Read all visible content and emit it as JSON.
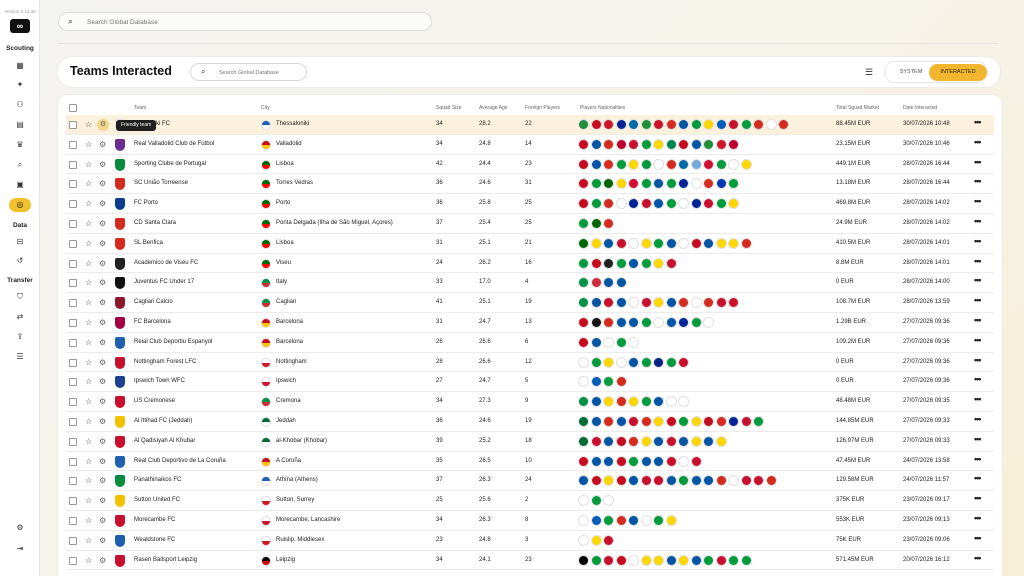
{
  "app": {
    "version": "Version 0.12.30",
    "logo_text": "∞",
    "sections": {
      "scouting": "Scouting",
      "data": "Data",
      "transfer": "Transfer"
    }
  },
  "top_search": {
    "placeholder": "Search Global Database"
  },
  "header": {
    "title": "Teams Interacted",
    "search_placeholder": "Search Global Database",
    "toggle": {
      "system": "SYSTEM",
      "interacted": "INTERACTED",
      "active": "interacted"
    }
  },
  "table": {
    "columns": {
      "team": "Team",
      "city": "City",
      "squad_size": "Squad Size",
      "average_age": "Average Age",
      "foreign_players": "Foreign Players",
      "players_nationalities": "Players Nationalities",
      "total_squad_market": "Total Squad Market",
      "date_interacted": "Date Interacted"
    },
    "tooltip": "Friendly team",
    "rows": [
      {
        "team": "Thessaloniki FC",
        "team_visible": "essaloniki FC",
        "city": "Thessaloniki",
        "squad": "34",
        "age": "28.2",
        "foreign": "22",
        "market": "88.45M EUR",
        "date": "30/07/2026 10:48",
        "cflag": [
          "#1f5fb0",
          "#ffffff"
        ],
        "crest": "#e6e6e6",
        "flags": [
          "#1f8f3a",
          "#c60b1e",
          "#cf142b",
          "#002395",
          "#006aa7",
          "#1f8f3a",
          "#ce1126",
          "#d52b1e",
          "#0055a4",
          "#009b3a",
          "#ffd700",
          "#005eb8",
          "#c8102e",
          "#009b3a",
          "#d52b1e",
          "#ffffff",
          "#d52b1e"
        ]
      },
      {
        "team": "Real Valladolid Club de Fútbol",
        "city": "Valladolid",
        "squad": "34",
        "age": "24.8",
        "foreign": "14",
        "market": "23.15M EUR",
        "date": "30/07/2026 10:46",
        "cflag": [
          "#c60b1e",
          "#ffc400"
        ],
        "crest": "#6a2c91",
        "flags": [
          "#c60b1e",
          "#0055a4",
          "#d52b1e",
          "#bc002d",
          "#c8102e",
          "#009b3a",
          "#ffd700",
          "#008751",
          "#c60b1e",
          "#0055a4",
          "#1f8f3a",
          "#cf142b",
          "#bc002d"
        ]
      },
      {
        "team": "Sporting Clube de Portugal",
        "city": "Lisboa",
        "squad": "42",
        "age": "24.4",
        "foreign": "23",
        "market": "449.1M EUR",
        "date": "28/07/2026 16:44",
        "cflag": [
          "#006600",
          "#ff0000"
        ],
        "crest": "#0a8a3c",
        "flags": [
          "#c60b1e",
          "#0055a4",
          "#d52b1e",
          "#009b3a",
          "#ffd700",
          "#009b3a",
          "#ffffff",
          "#d52b1e",
          "#006aa7",
          "#75aadb",
          "#d21034",
          "#009b3a",
          "#ffffff",
          "#ffd700"
        ]
      },
      {
        "team": "SC União Torreense",
        "city": "Torres Vedras",
        "squad": "36",
        "age": "24.6",
        "foreign": "31",
        "market": "13.18M EUR",
        "date": "28/07/2026 16:44",
        "cflag": [
          "#006600",
          "#ff0000"
        ],
        "crest": "#d52b1e",
        "flags": [
          "#c60b1e",
          "#009b3a",
          "#006600",
          "#ffd700",
          "#d21034",
          "#009b3a",
          "#0055a4",
          "#009b3a",
          "#002395",
          "#ffffff",
          "#d52b1e",
          "#0038b8",
          "#009b3a"
        ]
      },
      {
        "team": "FC Porto",
        "city": "Porto",
        "squad": "36",
        "age": "25.8",
        "foreign": "25",
        "market": "469.8M EUR",
        "date": "28/07/2026 14:02",
        "cflag": [
          "#006600",
          "#ff0000"
        ],
        "crest": "#0b3c8c",
        "flags": [
          "#c60b1e",
          "#009b3a",
          "#d52b1e",
          "#ffffff",
          "#002395",
          "#c8102e",
          "#0055a4",
          "#009b3a",
          "#ffffff",
          "#002395",
          "#c8102e",
          "#009b3a",
          "#ffd700"
        ]
      },
      {
        "team": "CD Santa Clara",
        "city": "Ponta Delgada (Ilha de São Miguel, Açores)",
        "squad": "37",
        "age": "25.4",
        "foreign": "25",
        "market": "24.9M EUR",
        "date": "28/07/2026 14:02",
        "cflag": [
          "#006600",
          "#ff0000"
        ],
        "crest": "#d52b1e",
        "flags": [
          "#009b3a",
          "#006600",
          "#d52b1e"
        ]
      },
      {
        "team": "SL Benfica",
        "city": "Lisboa",
        "squad": "31",
        "age": "25.1",
        "foreign": "21",
        "market": "410.5M EUR",
        "date": "28/07/2026 14:01",
        "cflag": [
          "#006600",
          "#ff0000"
        ],
        "crest": "#d52b1e",
        "flags": [
          "#006600",
          "#ffd700",
          "#0055a4",
          "#c8102e",
          "#ffffff",
          "#ffd700",
          "#009b3a",
          "#0055a4",
          "#ffffff",
          "#c60b1e",
          "#0055a4",
          "#ffd700",
          "#ffd700",
          "#d52b1e"
        ]
      },
      {
        "team": "Academico de Viseu FC",
        "city": "Viseu",
        "squad": "24",
        "age": "26.2",
        "foreign": "16",
        "market": "8.8M EUR",
        "date": "28/07/2026 14:01",
        "cflag": [
          "#006600",
          "#ff0000"
        ],
        "crest": "#222222",
        "flags": [
          "#009b3a",
          "#c60b1e",
          "#222222",
          "#009b3a",
          "#0055a4",
          "#009b3a",
          "#ffd700",
          "#c8102e"
        ]
      },
      {
        "team": "Juventus FC Under 17",
        "city": "Italy",
        "squad": "33",
        "age": "17.0",
        "foreign": "4",
        "market": "0 EUR",
        "date": "28/07/2026 14:00",
        "cflag": [
          "#009246",
          "#ce2b37"
        ],
        "crest": "#111111",
        "flags": [
          "#009246",
          "#cd2a3e",
          "#0055a4",
          "#0055a4"
        ]
      },
      {
        "team": "Cagliari Calcio",
        "city": "Cagliari",
        "squad": "41",
        "age": "25.1",
        "foreign": "19",
        "market": "108.7M EUR",
        "date": "28/07/2026 13:59",
        "cflag": [
          "#009246",
          "#ce2b37"
        ],
        "crest": "#8b1a2b",
        "flags": [
          "#009246",
          "#0055a4",
          "#c8102e",
          "#0055a4",
          "#ffffff",
          "#c8102e",
          "#ffd700",
          "#0055a4",
          "#d52b1e",
          "#ffffff",
          "#d52b1e",
          "#c8102e",
          "#ce1126"
        ]
      },
      {
        "team": "FC Barcelona",
        "city": "Barcelona",
        "squad": "31",
        "age": "24.7",
        "foreign": "13",
        "market": "1.29B EUR",
        "date": "27/07/2026 09:36",
        "cflag": [
          "#c60b1e",
          "#ffc400"
        ],
        "crest": "#a50044",
        "flags": [
          "#c60b1e",
          "#111111",
          "#d52b1e",
          "#0055a4",
          "#0055a4",
          "#009b3a",
          "#ffffff",
          "#0055a4",
          "#002395",
          "#009b3a",
          "#ffffff"
        ]
      },
      {
        "team": "Reial Club Deportiu Espanyol",
        "city": "Barcelona",
        "squad": "26",
        "age": "26.6",
        "foreign": "6",
        "market": "109.2M EUR",
        "date": "27/07/2026 09:36",
        "cflag": [
          "#c60b1e",
          "#ffc400"
        ],
        "crest": "#1f5fb0",
        "flags": [
          "#c60b1e",
          "#0055a4",
          "#ffffff",
          "#009b3a",
          "#ffffff"
        ]
      },
      {
        "team": "Nottingham Forest LFC",
        "city": "Nottingham",
        "squad": "28",
        "age": "26.6",
        "foreign": "12",
        "market": "0 EUR",
        "date": "27/07/2026 09:36",
        "cflag": [
          "#ffffff",
          "#cf142b"
        ],
        "crest": "#c8102e",
        "flags": [
          "#ffffff",
          "#009b3a",
          "#ffd700",
          "#ffffff",
          "#0055a4",
          "#009b3a",
          "#00247d",
          "#009b3a",
          "#c8102e"
        ]
      },
      {
        "team": "Ipswich Town WFC",
        "city": "Ipswich",
        "squad": "27",
        "age": "24.7",
        "foreign": "5",
        "market": "0 EUR",
        "date": "27/07/2026 09:36",
        "cflag": [
          "#ffffff",
          "#cf142b"
        ],
        "crest": "#1d3f8f",
        "flags": [
          "#ffffff",
          "#005eb8",
          "#009b3a",
          "#d52b1e"
        ]
      },
      {
        "team": "US Cremonese",
        "city": "Cremona",
        "squad": "34",
        "age": "27.3",
        "foreign": "9",
        "market": "48.48M EUR",
        "date": "27/07/2026 09:35",
        "cflag": [
          "#009246",
          "#ce2b37"
        ],
        "crest": "#c8102e",
        "flags": [
          "#009246",
          "#0055a4",
          "#ffd700",
          "#d52b1e",
          "#ffd700",
          "#009b3a",
          "#0055a4",
          "#ffffff",
          "#ffffff"
        ]
      },
      {
        "team": "Al Ittihad FC (Jeddah)",
        "city": "Jeddah",
        "squad": "36",
        "age": "24.6",
        "foreign": "19",
        "market": "144.85M EUR",
        "date": "27/07/2026 09:33",
        "cflag": [
          "#006c35",
          "#ffffff"
        ],
        "crest": "#f2c200",
        "flags": [
          "#006c35",
          "#0055a4",
          "#d52b1e",
          "#0055a4",
          "#c8102e",
          "#d52b1e",
          "#ffd700",
          "#c60b1e",
          "#009b3a",
          "#ffd700",
          "#c60b1e",
          "#d52b1e",
          "#002395",
          "#c8102e",
          "#009b3a"
        ]
      },
      {
        "team": "Al Qadisiyah Al Khubar",
        "city": "al-Khobar (Khobar)",
        "squad": "39",
        "age": "25.2",
        "foreign": "18",
        "market": "126.97M EUR",
        "date": "27/07/2026 09:33",
        "cflag": [
          "#006c35",
          "#ffffff"
        ],
        "crest": "#c8102e",
        "flags": [
          "#006c35",
          "#c8102e",
          "#0055a4",
          "#c60b1e",
          "#d52b1e",
          "#ffd700",
          "#0055a4",
          "#c8102e",
          "#0055a4",
          "#ffd700",
          "#0055a4",
          "#ffd700"
        ]
      },
      {
        "team": "Real Club Deportivo de La Coruña",
        "city": "A Coruña",
        "squad": "35",
        "age": "26.5",
        "foreign": "10",
        "market": "47.45M EUR",
        "date": "24/07/2026 13:58",
        "cflag": [
          "#c60b1e",
          "#ffc400"
        ],
        "crest": "#1f5fb0",
        "flags": [
          "#c60b1e",
          "#0055a4",
          "#0055a4",
          "#c60b1e",
          "#009b3a",
          "#0055a4",
          "#0055a4",
          "#c8102e",
          "#ffffff",
          "#c8102e"
        ]
      },
      {
        "team": "Panathinaikos FC",
        "city": "Athína (Athens)",
        "squad": "37",
        "age": "26.3",
        "foreign": "24",
        "market": "129.58M EUR",
        "date": "24/07/2026 11:57",
        "cflag": [
          "#1f5fb0",
          "#ffffff"
        ],
        "crest": "#0a8a3c",
        "flags": [
          "#0055a4",
          "#c60b1e",
          "#ffd700",
          "#c60b1e",
          "#0055a4",
          "#c8102e",
          "#c8102e",
          "#0055a4",
          "#009b3a",
          "#0055a4",
          "#0055a4",
          "#d52b1e",
          "#ffffff",
          "#c8102e",
          "#c8102e",
          "#d52b1e"
        ]
      },
      {
        "team": "Sutton United FC",
        "city": "Sutton, Surrey",
        "squad": "25",
        "age": "25.6",
        "foreign": "2",
        "market": "375K EUR",
        "date": "23/07/2026 09:17",
        "cflag": [
          "#ffffff",
          "#cf142b"
        ],
        "crest": "#f2c200",
        "flags": [
          "#ffffff",
          "#009b3a",
          "#ffffff"
        ]
      },
      {
        "team": "Morecambe FC",
        "city": "Morecambe, Lancashire",
        "squad": "34",
        "age": "26.3",
        "foreign": "8",
        "market": "553K EUR",
        "date": "23/07/2026 09:13",
        "cflag": [
          "#ffffff",
          "#cf142b"
        ],
        "crest": "#c8102e",
        "flags": [
          "#ffffff",
          "#005eb8",
          "#009b3a",
          "#d52b1e",
          "#0055a4",
          "#ffffff",
          "#009b3a",
          "#ffd700"
        ]
      },
      {
        "team": "Wealdstone FC",
        "city": "Ruislip, Middlesex",
        "squad": "23",
        "age": "24.8",
        "foreign": "3",
        "market": "75K EUR",
        "date": "23/07/2026 09:06",
        "cflag": [
          "#ffffff",
          "#cf142b"
        ],
        "crest": "#1f5fb0",
        "flags": [
          "#ffffff",
          "#ffd700",
          "#c8102e"
        ]
      },
      {
        "team": "Rasen Ballsport Leipzig",
        "city": "Leipzig",
        "squad": "34",
        "age": "24.1",
        "foreign": "23",
        "market": "571.45M EUR",
        "date": "20/07/2026 16:12",
        "cflag": [
          "#000000",
          "#dd0000"
        ],
        "crest": "#c8102e",
        "flags": [
          "#000000",
          "#009b3a",
          "#c8102e",
          "#c60b1e",
          "#ffffff",
          "#ffd700",
          "#ffd700",
          "#0055a4",
          "#ffd700",
          "#0055a4",
          "#009b3a",
          "#c8102e",
          "#009b3a",
          "#009b3a"
        ]
      }
    ]
  },
  "colors": {
    "accent": "#f2b52e",
    "row_highlight": "#fbf1dd"
  }
}
